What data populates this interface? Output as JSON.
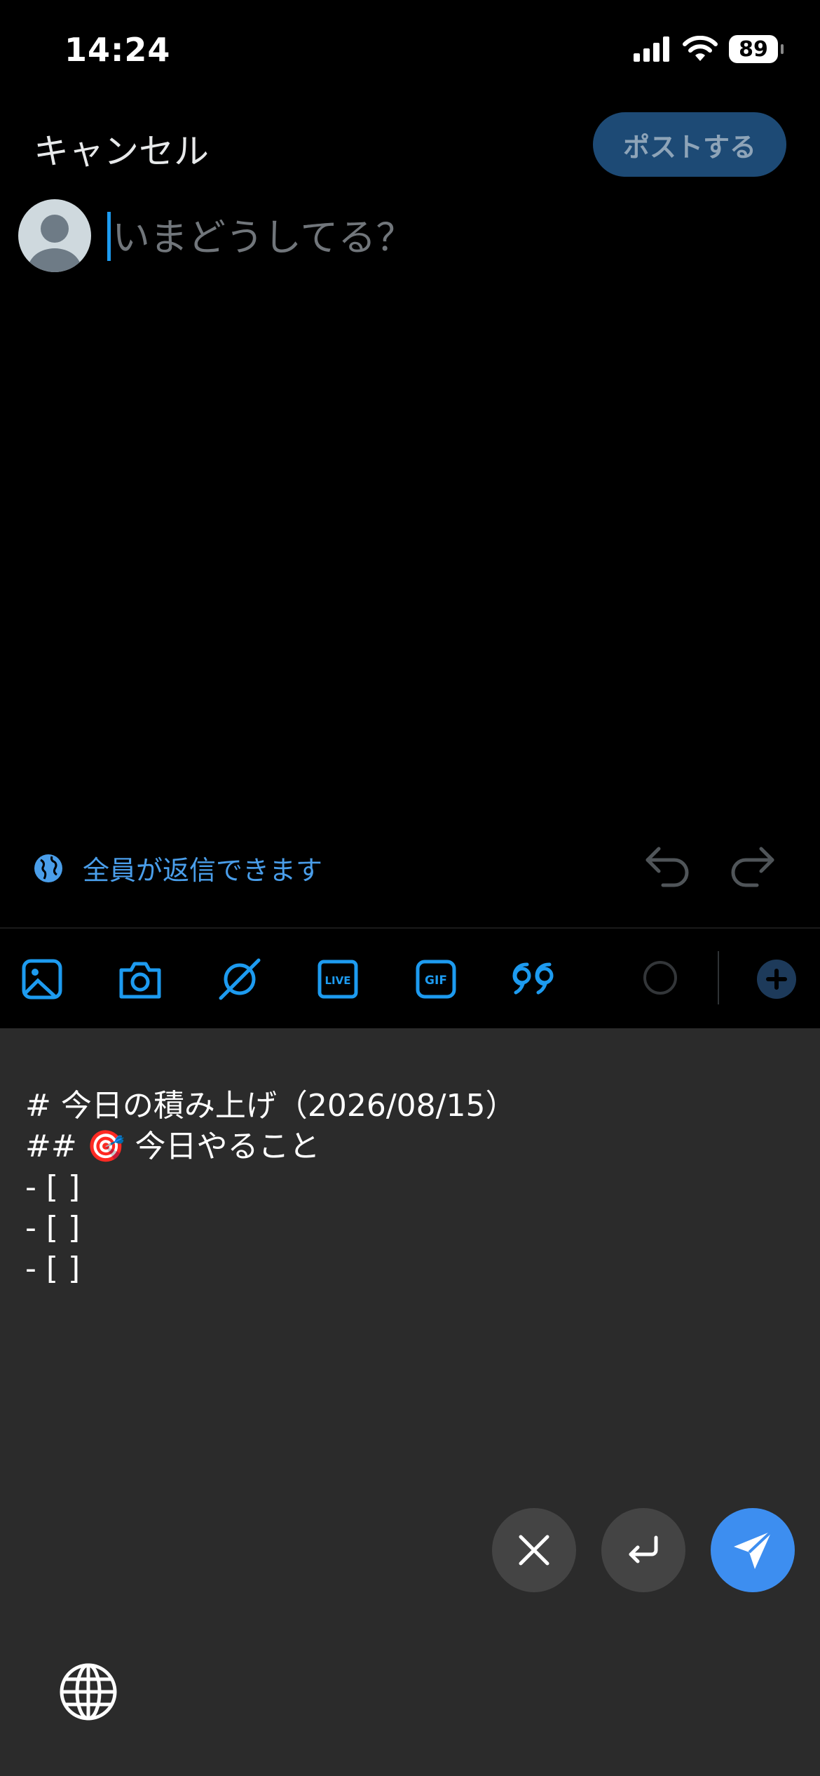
{
  "status_bar": {
    "time": "14:24",
    "battery": "89"
  },
  "header": {
    "cancel_label": "キャンセル",
    "post_label": "ポストする"
  },
  "compose": {
    "placeholder": "いまどうしてる？",
    "value": ""
  },
  "reply_setting": {
    "label": "全員が返信できます"
  },
  "toolbar": {
    "icons": [
      "image-icon",
      "camera-icon",
      "grok-icon",
      "live-icon",
      "gif-icon",
      "quote-icon"
    ],
    "live_label": "LIVE",
    "gif_label": "GIF"
  },
  "template": {
    "lines": [
      "# 今日の積み上げ（2026/08/15）",
      "",
      "## 🎯 今日やること",
      "- [ ]",
      "- [ ]",
      "- [ ]"
    ]
  },
  "colors": {
    "accent": "#1d9bf0",
    "send": "#3d8ef0",
    "panel": "#2b2b2b"
  }
}
